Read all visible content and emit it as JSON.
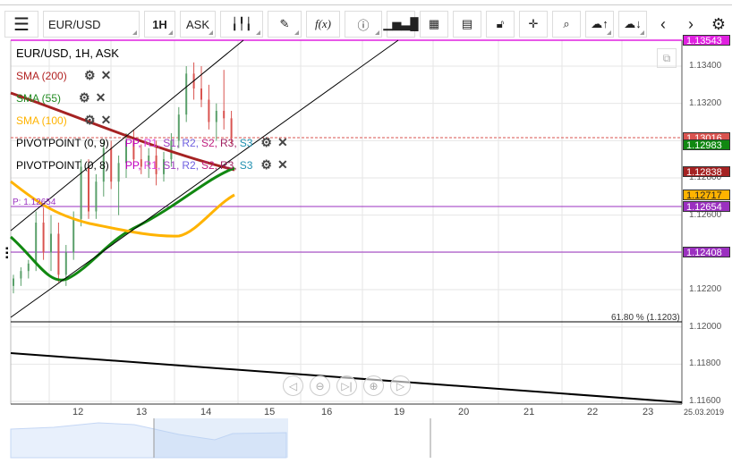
{
  "toolbar": {
    "symbol": "EUR/USD",
    "timeframe": "1H",
    "price_side": "ASK",
    "function_label": "f(x)"
  },
  "legend": {
    "title": "EUR/USD, 1H, ASK",
    "indicators": [
      {
        "label": "SMA (200)",
        "color": "#b22222"
      },
      {
        "label": "SMA (55)",
        "color": "#228b22"
      },
      {
        "label": "SMA (100)",
        "color": "#ffb300"
      }
    ],
    "pivots": [
      {
        "label": "PIVOTPOINT (0, 9)"
      },
      {
        "label": "PIVOTPOINT (0, 8)"
      }
    ],
    "pivot_parts": [
      {
        "t": "PP,",
        "c": "#c000c0"
      },
      {
        "t": "R1,",
        "c": "#e040e0"
      },
      {
        "t": "S1,",
        "c": "#a040c0"
      },
      {
        "t": "R2,",
        "c": "#7060e0"
      },
      {
        "t": "S2,",
        "c": "#c02080"
      },
      {
        "t": "R3,",
        "c": "#a02060"
      },
      {
        "t": "S3",
        "c": "#2090b0"
      }
    ]
  },
  "pivot_label": "P: 1.12654",
  "fib_label": "61.80 % (1.1203)",
  "price_axis": [
    "1.13400",
    "1.13200",
    "1.13000",
    "1.12800",
    "1.12600",
    "1.12400",
    "1.12200",
    "1.12000",
    "1.11800",
    "1.11600"
  ],
  "price_tags": [
    {
      "v": "1.13543",
      "c": "#e020e0"
    },
    {
      "v": "1.13016",
      "c": "#d9534f"
    },
    {
      "v": "1.12983",
      "c": "#118811"
    },
    {
      "v": "1.12838",
      "c": "#a52222"
    },
    {
      "v": "1.12717",
      "c": "#ffb300",
      "dark": true
    },
    {
      "v": "1.12654",
      "c": "#9b30c0"
    },
    {
      "v": "1.12408",
      "c": "#9b30c0"
    }
  ],
  "time_axis": [
    "12",
    "13",
    "14",
    "15",
    "16",
    "19",
    "20",
    "21",
    "22",
    "23"
  ],
  "date_label": "25.03.2019",
  "chart_data": {
    "type": "candlestick",
    "symbol": "EUR/USD",
    "interval": "1H",
    "candles": [
      [
        1.1222,
        1.1228,
        1.1218,
        1.1226
      ],
      [
        1.1226,
        1.1232,
        1.1222,
        1.123
      ],
      [
        1.123,
        1.1236,
        1.1226,
        1.1234
      ],
      [
        1.1234,
        1.1262,
        1.123,
        1.1256
      ],
      [
        1.1256,
        1.1264,
        1.1236,
        1.124
      ],
      [
        1.124,
        1.126,
        1.123,
        1.125
      ],
      [
        1.125,
        1.1256,
        1.1224,
        1.1228
      ],
      [
        1.1228,
        1.1244,
        1.1222,
        1.124
      ],
      [
        1.124,
        1.1262,
        1.1236,
        1.1258
      ],
      [
        1.1258,
        1.129,
        1.1254,
        1.1286
      ],
      [
        1.1286,
        1.129,
        1.1258,
        1.1262
      ],
      [
        1.1262,
        1.1282,
        1.1258,
        1.1278
      ],
      [
        1.1278,
        1.13,
        1.127,
        1.1296
      ],
      [
        1.1296,
        1.13,
        1.1274,
        1.1278
      ],
      [
        1.1278,
        1.1292,
        1.126,
        1.1288
      ],
      [
        1.1288,
        1.1304,
        1.128,
        1.13
      ],
      [
        1.13,
        1.1306,
        1.1286,
        1.129
      ],
      [
        1.129,
        1.1298,
        1.1282,
        1.1286
      ],
      [
        1.1286,
        1.1296,
        1.128,
        1.1292
      ],
      [
        1.1292,
        1.13,
        1.1276,
        1.1282
      ],
      [
        1.1282,
        1.1294,
        1.1278,
        1.129
      ],
      [
        1.129,
        1.1304,
        1.1286,
        1.13
      ],
      [
        1.13,
        1.1318,
        1.1296,
        1.1314
      ],
      [
        1.1314,
        1.134,
        1.131,
        1.1336
      ],
      [
        1.1336,
        1.1342,
        1.1322,
        1.1328
      ],
      [
        1.1328,
        1.134,
        1.1318,
        1.1322
      ],
      [
        1.1322,
        1.133,
        1.1306,
        1.131
      ],
      [
        1.131,
        1.132,
        1.13,
        1.1316
      ],
      [
        1.1316,
        1.1338,
        1.1306,
        1.1312
      ],
      [
        1.1312,
        1.1316,
        1.1298,
        1.1302
      ]
    ],
    "ylim": [
      1.116,
      1.1356
    ]
  }
}
